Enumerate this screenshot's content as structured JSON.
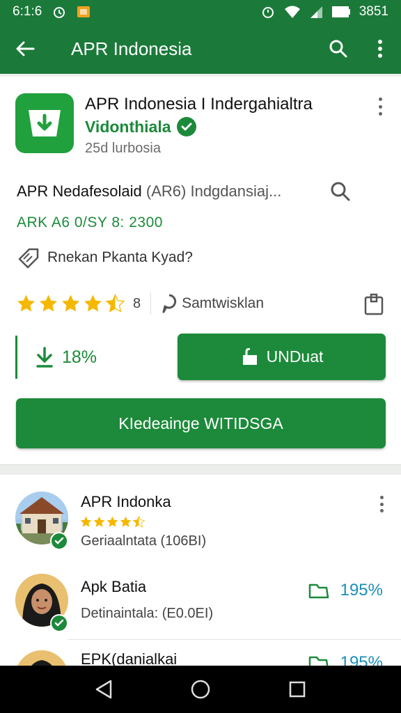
{
  "status_bar": {
    "time": "6:1:6",
    "battery": "3851"
  },
  "app_bar": {
    "title": "APR Indonesia"
  },
  "app": {
    "title": "APR Indonesia I Indergahialtra",
    "developer": "Vidonthiala",
    "subtitle": "25d lurbosia",
    "headline": "APR Nedafesolaid",
    "headline_muted": "(AR6) Indgdansiaj...",
    "version": "ARK A6 0/SY 8: 2300",
    "tag": "Rnekan Pkanta Kyad?",
    "rating_value": 4.5,
    "rating_count": "8",
    "community_label": "Samtwisklan",
    "download_progress": "18%",
    "unduh_label": "UNDuat",
    "wide_button": "KIedeainge WITIDSGA"
  },
  "list": [
    {
      "title": "APR Indonka",
      "subtitle": "Geriaalntata (106BI)",
      "rating": 4.5,
      "avatar": "building"
    },
    {
      "title": "Apk Batia",
      "subtitle": "Detinaintala: (E0.0EI)",
      "percent": "195%",
      "avatar": "woman"
    },
    {
      "title": "EPK(danialkai",
      "percent": "195%",
      "avatar": "woman"
    }
  ],
  "colors": {
    "primary": "#1b7a3a",
    "accent": "#1c8a3a",
    "star": "#f5b800",
    "link": "#1a8fb8"
  },
  "icons": [
    "back-arrow-icon",
    "search-icon",
    "more-vert-icon",
    "verified-icon",
    "tag-icon",
    "star-icon",
    "comment-icon",
    "copy-icon",
    "download-icon",
    "lock-icon",
    "folder-icon",
    "nav-back-icon",
    "nav-home-icon",
    "nav-recents-icon"
  ]
}
